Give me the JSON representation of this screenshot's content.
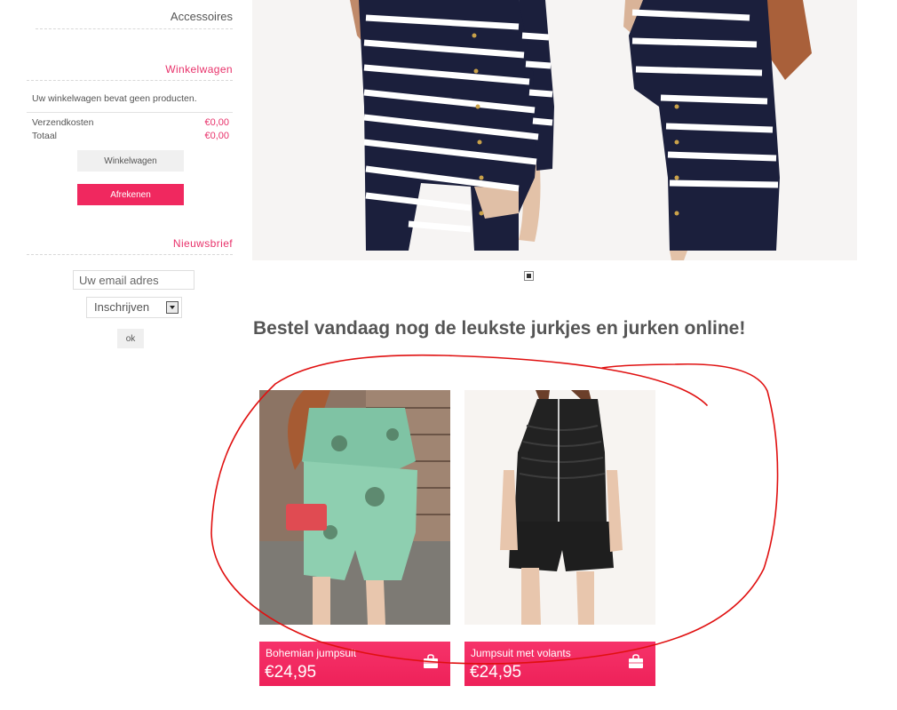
{
  "sidebar": {
    "category_item": "Accessoires",
    "cart": {
      "title": "Winkelwagen",
      "empty_message": "Uw winkelwagen bevat geen producten.",
      "shipping_label": "Verzendkosten",
      "shipping_value": "€0,00",
      "total_label": "Totaal",
      "total_value": "€0,00",
      "view_cart_button": "Winkelwagen",
      "checkout_button": "Afrekenen"
    },
    "newsletter": {
      "title": "Nieuwsbrief",
      "email_placeholder": "Uw email adres",
      "subscribe_select": "Inschrijven",
      "ok_button": "ok"
    }
  },
  "main": {
    "headline": "Bestel vandaag nog de leukste jurkjes en jurken online!",
    "products": [
      {
        "name": "Bohemian jumpsuit",
        "price": "€24,95"
      },
      {
        "name": "Jumpsuit met volants",
        "price": "€24,95"
      }
    ]
  },
  "colors": {
    "accent": "#f0285f",
    "annotation": "#e01010"
  }
}
